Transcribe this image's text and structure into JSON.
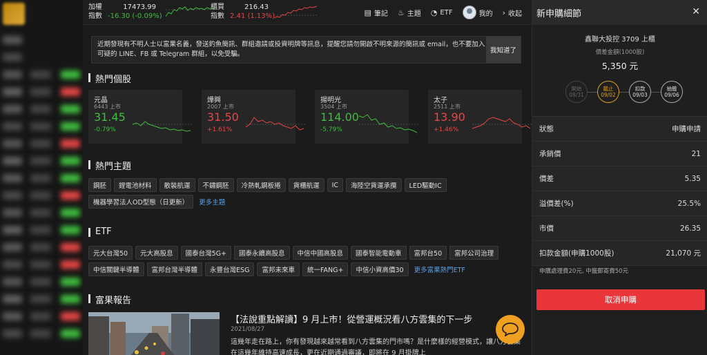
{
  "indices": [
    {
      "name_line1": "加權",
      "name_line2": "指數",
      "value": "17473.99",
      "change": "-16.30 (-0.09%)",
      "direction": "down"
    },
    {
      "name_line1": "櫃買",
      "name_line2": "指數",
      "value": "216.43",
      "change": "2.41 (1.13%)",
      "direction": "up"
    }
  ],
  "topnav": {
    "notes": "筆記",
    "themes": "主題",
    "etf": "ETF",
    "mine": "我的",
    "collapse": "收起"
  },
  "notice": {
    "text": "近期發現有不明人士以富果名義，發送釣魚簡訊、群組邀請或投資明牌等訊息，提醒您請勿開啟不明來源的簡訊或 email，也不要加入可疑的 LINE、FB 或 Telegram 群組，以免受騙。",
    "button": "我知道了"
  },
  "sections": {
    "hot_stocks": "熱門個股",
    "hot_themes": "熱門主題",
    "etf": "ETF",
    "reports": "富果報告"
  },
  "hot_stocks": [
    {
      "name": "元晶",
      "code": "6443 上市",
      "price": "31.45",
      "change": "-0.79%",
      "direction": "down"
    },
    {
      "name": "燁興",
      "code": "2007 上市",
      "price": "31.50",
      "change": "+1.61%",
      "direction": "up"
    },
    {
      "name": "揚明光",
      "code": "3504 上市",
      "price": "114.00",
      "change": "-5.79%",
      "direction": "down"
    },
    {
      "name": "太子",
      "code": "2511 上市",
      "price": "13.90",
      "change": "+1.46%",
      "direction": "up"
    }
  ],
  "themes": {
    "items": [
      "鋼胚",
      "鋰電池材料",
      "散裝航運",
      "不鏽鋼胚",
      "冷熱軋鋼板捲",
      "貨櫃航運",
      "IC",
      "海陸空貨運承攬",
      "LED驅動IC",
      "機器學習法人OD型態（日更新）"
    ],
    "more": "更多主題"
  },
  "etfs": {
    "items": [
      "元大台灣50",
      "元大高股息",
      "國泰台灣5G+",
      "國泰永續高股息",
      "中信中國高股息",
      "國泰智能電動車",
      "富邦台50",
      "富邦公司治理",
      "中信關鍵半導體",
      "富邦台灣半導體",
      "永豐台灣ESG",
      "富邦未來車",
      "統一FANG+",
      "中信小資高價30"
    ],
    "more": "更多富果熱門ETF"
  },
  "report": {
    "title": "【法說重點解讀】9 月上市！從營運概況看八方雲集的下一步",
    "date": "2021/08/27",
    "body": "這幾年走在路上，你有發現越來越常看到八方雲集的門市嗎？是什麼樣的經營模式，讓八方雲集在這幾年維持高速成長，更在近期通過審議，即將在 9 月掛牌上"
  },
  "panel": {
    "title": "新申購細節",
    "stock": "鑫聯大投控 3709 上櫃",
    "diff_label": "價差金額(1000股)",
    "diff_value": "5,350 元",
    "steps": [
      {
        "label": "開始",
        "date": "08/31",
        "state": "dim"
      },
      {
        "label": "截止",
        "date": "09/02",
        "state": "active"
      },
      {
        "label": "扣款",
        "date": "09/03",
        "state": "done"
      },
      {
        "label": "抽籤",
        "date": "09/06",
        "state": "done"
      }
    ],
    "rows": [
      {
        "label": "狀態",
        "value": "申購申請"
      },
      {
        "label": "承銷價",
        "value": "21"
      },
      {
        "label": "價差",
        "value": "5.35"
      },
      {
        "label": "溢價差(%)",
        "value": "25.5%"
      },
      {
        "label": "市價",
        "value": "26.35"
      },
      {
        "label": "扣款金額(申購1000股)",
        "value": "21,070 元"
      }
    ],
    "fee": "申購處理費20元, 中籤郵寄費50元",
    "cancel": "取消申購"
  },
  "colors": {
    "up": "#e84545",
    "down": "#3fbf3f",
    "accent": "#e0a020",
    "cancel": "#e8363b"
  }
}
